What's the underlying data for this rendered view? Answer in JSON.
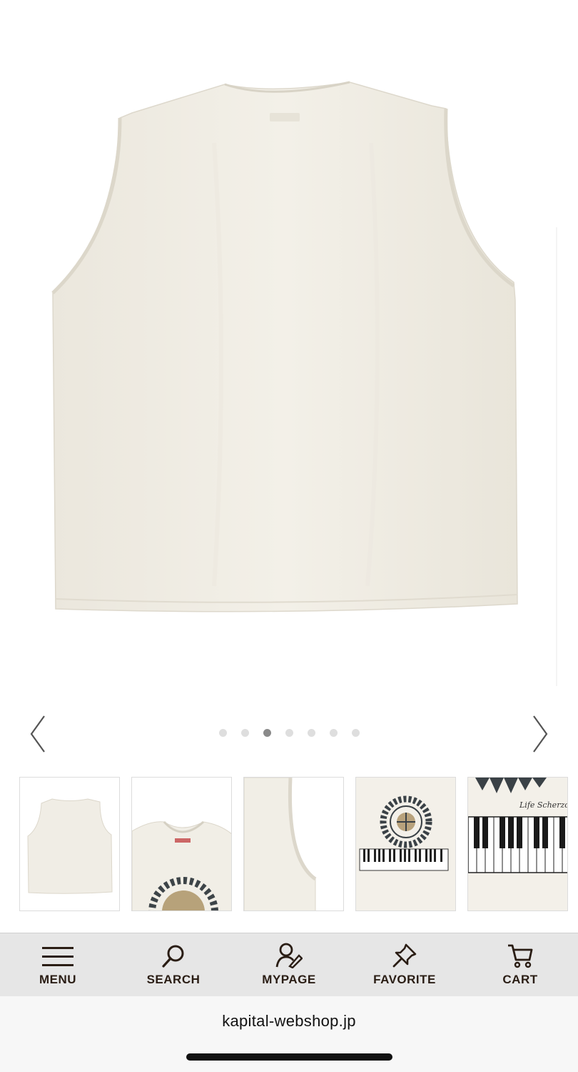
{
  "product_image": {
    "name": "sleeveless-tank-back-view",
    "color": "#f1eee6"
  },
  "carousel": {
    "prev_icon": "chevron-left-icon",
    "next_icon": "chevron-right-icon",
    "slide_count": 7,
    "active_index": 2
  },
  "thumbnails": [
    {
      "name": "tank-back-full"
    },
    {
      "name": "tank-front-collar-detail"
    },
    {
      "name": "tank-armhole-detail"
    },
    {
      "name": "tank-print-sunflower-piano"
    },
    {
      "name": "tank-print-piano-closeup",
      "script_text": "Life Scherzo"
    }
  ],
  "bottom_nav": {
    "items": [
      {
        "label": "MENU",
        "icon": "hamburger-menu-icon"
      },
      {
        "label": "SEARCH",
        "icon": "search-icon"
      },
      {
        "label": "MYPAGE",
        "icon": "user-icon"
      },
      {
        "label": "FAVORITE",
        "icon": "pin-icon"
      },
      {
        "label": "CART",
        "icon": "cart-icon"
      }
    ]
  },
  "browser": {
    "url": "kapital-webshop.jp"
  }
}
